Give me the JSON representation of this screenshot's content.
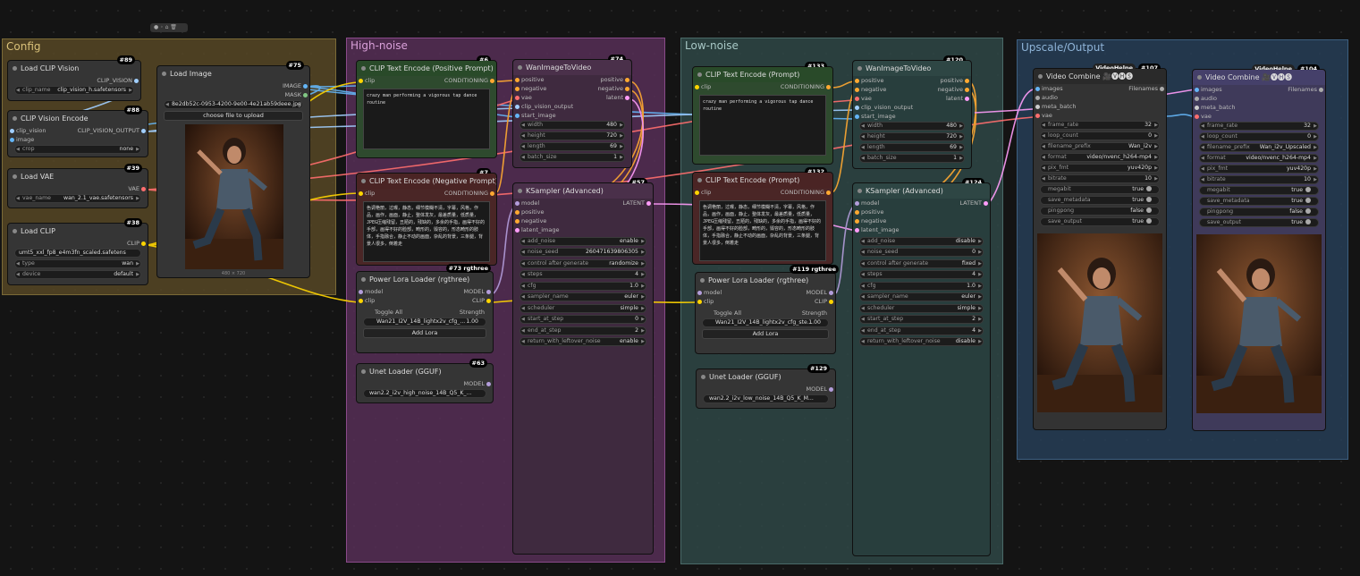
{
  "toolbar": {
    "icons": "● ◦ ⌂ 🗑"
  },
  "groups": {
    "config": "Config",
    "high": "High-noise",
    "low": "Low-noise",
    "upscale": "Upscale/Output"
  },
  "n89": {
    "id": "#89",
    "title": "Load CLIP Vision",
    "out": "CLIP_VISION",
    "w_label": "clip_name",
    "w_val": "clip_vision_h.safetensors"
  },
  "n88": {
    "id": "#88",
    "title": "CLIP Vision Encode",
    "in1": "clip_vision",
    "in2": "image",
    "out": "CLIP_VISION_OUTPUT",
    "w_label": "crop",
    "w_val": "none"
  },
  "n39": {
    "id": "#39",
    "title": "Load VAE",
    "out": "VAE",
    "w_label": "vae_name",
    "w_val": "wan_2.1_vae.safetensors"
  },
  "n38": {
    "id": "#38",
    "title": "Load CLIP",
    "out": "CLIP",
    "w1_val": "umt5_xxl_fp8_e4m3fn_scaled.safetens",
    "w2_label": "type",
    "w2_val": "wan",
    "w3_label": "device",
    "w3_val": "default"
  },
  "n75": {
    "id": "#75",
    "title": "Load Image",
    "out1": "IMAGE",
    "out2": "MASK",
    "file": "8e2db52c-0953-4200-9e00-4e21ab59deee.jpg",
    "upload": "choose file to upload",
    "size": "480 × 720"
  },
  "n6": {
    "id": "#6",
    "title": "CLIP Text Encode (Positive Prompt)",
    "in": "clip",
    "out": "CONDITIONING",
    "text": "crazy man performing a vigorous tap dance routine"
  },
  "n7": {
    "id": "#7",
    "title": "CLIP Text Encode (Negative Prompt)",
    "in": "clip",
    "out": "CONDITIONING",
    "text": "色调艳丽，过曝，静态，细节模糊不清，字幕，风格，作品，画作，画面，静止，整体发灰，最差质量，低质量，JPEG压缩残留，丑陋的，残缺的，多余的手指，画得不好的手部，画得不好的脸部，畸形的，毁容的，形态畸形的肢体，手指融合，静止不动的画面，杂乱的背景，三条腿，背景人很多，倒着走"
  },
  "n73": {
    "id": "#73 rgthree",
    "title": "Power Lora Loader (rgthree)",
    "in1": "model",
    "in2": "clip",
    "out1": "MODEL",
    "out2": "CLIP",
    "toggle": "Toggle All",
    "strength": "Strength",
    "lora": "Wan21_I2V_14B_lightx2v_cfg_...",
    "lora_val": "1.00",
    "add": "Add Lora"
  },
  "n63": {
    "id": "#63",
    "title": "Unet Loader (GGUF)",
    "out": "MODEL",
    "w_val": "wan2.2_i2v_high_noise_14B_Q5_K_..."
  },
  "n74": {
    "id": "#74",
    "title": "WanImageToVideo",
    "ins": [
      "positive",
      "negative",
      "vae",
      "clip_vision_output",
      "start_image"
    ],
    "outs": [
      "positive",
      "negative",
      "latent"
    ],
    "w": [
      [
        "width",
        "480"
      ],
      [
        "height",
        "720"
      ],
      [
        "length",
        "69"
      ],
      [
        "batch_size",
        "1"
      ]
    ]
  },
  "n57": {
    "id": "#57",
    "title": "KSampler (Advanced)",
    "ins": [
      "model",
      "positive",
      "negative",
      "latent_image"
    ],
    "out": "LATENT",
    "w": [
      [
        "add_noise",
        "enable"
      ],
      [
        "noise_seed",
        "260471639806305"
      ],
      [
        "control after generate",
        "randomize"
      ],
      [
        "steps",
        "4"
      ],
      [
        "cfg",
        "1.0"
      ],
      [
        "sampler_name",
        "euler"
      ],
      [
        "scheduler",
        "simple"
      ],
      [
        "start_at_step",
        "0"
      ],
      [
        "end_at_step",
        "2"
      ],
      [
        "return_with_leftover_noise",
        "enable"
      ]
    ]
  },
  "n133": {
    "id": "#133",
    "title": "CLIP Text Encode (Prompt)",
    "in": "clip",
    "out": "CONDITIONING",
    "text": "crazy man performing a vigorous tap dance routine"
  },
  "n132": {
    "id": "#132",
    "title": "CLIP Text Encode (Prompt)",
    "in": "clip",
    "out": "CONDITIONING",
    "text": "色调艳丽，过曝，静态，细节模糊不清，字幕，风格，作品，画作，画面，静止，整体发灰，最差质量，低质量，JPEG压缩残留，丑陋的，残缺的，多余的手指，画得不好的手部，画得不好的脸部，畸形的，毁容的，形态畸形的肢体，手指融合，静止不动的画面，杂乱的背景，三条腿，背景人很多，倒着走"
  },
  "n119": {
    "id": "#119 rgthree",
    "title": "Power Lora Loader (rgthree)",
    "in1": "model",
    "in2": "clip",
    "out1": "MODEL",
    "out2": "CLIP",
    "toggle": "Toggle All",
    "strength": "Strength",
    "lora": "Wan21_I2V_14B_lightx2v_cfg_ste...",
    "lora_val": "1.00",
    "add": "Add Lora"
  },
  "n129": {
    "id": "#129",
    "title": "Unet Loader (GGUF)",
    "out": "MODEL",
    "w_val": "wan2.2_i2v_low_noise_14B_Q5_K_M..."
  },
  "n120": {
    "id": "#120",
    "title": "WanImageToVideo",
    "ins": [
      "positive",
      "negative",
      "vae",
      "clip_vision_output",
      "start_image"
    ],
    "outs": [
      "positive",
      "negative",
      "latent"
    ],
    "w": [
      [
        "width",
        "480"
      ],
      [
        "height",
        "720"
      ],
      [
        "length",
        "69"
      ],
      [
        "batch_size",
        "1"
      ]
    ]
  },
  "n124": {
    "id": "#124",
    "title": "KSampler (Advanced)",
    "ins": [
      "model",
      "positive",
      "negative",
      "latent_image"
    ],
    "out": "LATENT",
    "w": [
      [
        "add_noise",
        "disable"
      ],
      [
        "noise_seed",
        "0"
      ],
      [
        "control after generate",
        "fixed"
      ],
      [
        "steps",
        "4"
      ],
      [
        "cfg",
        "1.0"
      ],
      [
        "sampler_name",
        "euler"
      ],
      [
        "scheduler",
        "simple"
      ],
      [
        "start_at_step",
        "2"
      ],
      [
        "end_at_step",
        "4"
      ],
      [
        "return_with_leftover_noise",
        "disable"
      ]
    ]
  },
  "n107": {
    "id": "#107",
    "badge": "VideoHelpe",
    "title": "Video Combine 🎥🅥🅗🅢",
    "ins": [
      "images",
      "audio",
      "meta_batch",
      "vae"
    ],
    "out": "Filenames",
    "w": [
      [
        "frame_rate",
        "32"
      ],
      [
        "loop_count",
        "0"
      ],
      [
        "filename_prefix",
        "Wan_i2v"
      ],
      [
        "format",
        "video/nvenc_h264-mp4"
      ],
      [
        "pix_fmt",
        "yuv420p"
      ],
      [
        "bitrate",
        "10"
      ],
      [
        "megabit",
        "true"
      ],
      [
        "save_metadata",
        "true"
      ],
      [
        "pingpong",
        "false"
      ],
      [
        "save_output",
        "true"
      ]
    ]
  },
  "n104": {
    "id": "#104",
    "badge": "VideoHelpe",
    "title": "Video Combine 🎥🅥🅗🅢",
    "ins": [
      "images",
      "audio",
      "meta_batch",
      "vae"
    ],
    "out": "Filenames",
    "w": [
      [
        "frame_rate",
        "32"
      ],
      [
        "loop_count",
        "0"
      ],
      [
        "filename_prefix",
        "Wan_i2v_Upscaled"
      ],
      [
        "format",
        "video/nvenc_h264-mp4"
      ],
      [
        "pix_fmt",
        "yuv420p"
      ],
      [
        "bitrate",
        "10"
      ],
      [
        "megabit",
        "true"
      ],
      [
        "save_metadata",
        "true"
      ],
      [
        "pingpong",
        "false"
      ],
      [
        "save_output",
        "true"
      ]
    ]
  }
}
